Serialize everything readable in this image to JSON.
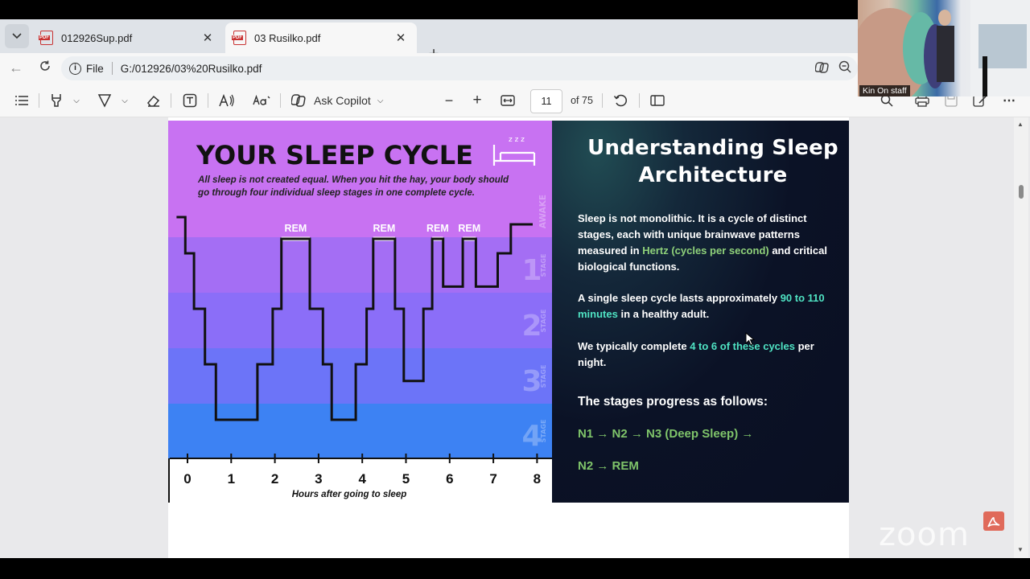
{
  "tabs": [
    {
      "title": "012926Sup.pdf",
      "close": "✕"
    },
    {
      "title": "03 Rusilko.pdf",
      "close": "✕"
    }
  ],
  "new_tab_label": "+",
  "address": {
    "scheme_label": "File",
    "url": "G:/012926/03%20Rusilko.pdf"
  },
  "pdf_toolbar": {
    "copilot_label": "Ask Copilot",
    "zoom_out": "−",
    "zoom_in": "+",
    "current_page": "11",
    "total_pages": "of 75"
  },
  "slide": {
    "title": "YOUR SLEEP CYCLE",
    "subtitle": "All sleep is not created equal. When you hit the hay, your body should go through four individual sleep stages in one complete cycle.",
    "xlabel": "Hours after going to sleep",
    "rem_label": "REM",
    "zzz": "z z z"
  },
  "chart_data": {
    "type": "line",
    "title": "YOUR SLEEP CYCLE",
    "xlabel": "Hours after going to sleep",
    "ylabel": "",
    "x_ticks": [
      "0",
      "1",
      "2",
      "3",
      "4",
      "5",
      "6",
      "7",
      "8"
    ],
    "xlim": [
      0,
      8
    ],
    "bands": [
      {
        "label": "AWAKE",
        "number": "",
        "color": "#c872f2"
      },
      {
        "label": "STAGE",
        "number": "1",
        "color": "#a46ef4"
      },
      {
        "label": "STAGE",
        "number": "2",
        "color": "#8b6ef8"
      },
      {
        "label": "STAGE",
        "number": "3",
        "color": "#6c74f8"
      },
      {
        "label": "STAGE",
        "number": "4",
        "color": "#3d82f3"
      }
    ],
    "stage_levels": {
      "awake": 0,
      "rem": 0.6,
      "stage1": 1,
      "stage2": 2,
      "stage3": 3,
      "stage4": 4
    },
    "hypnogram": [
      [
        -0.25,
        0
      ],
      [
        -0.05,
        0
      ],
      [
        -0.05,
        1
      ],
      [
        0.15,
        1
      ],
      [
        0.15,
        2
      ],
      [
        0.4,
        2
      ],
      [
        0.4,
        3
      ],
      [
        0.65,
        3
      ],
      [
        0.65,
        4
      ],
      [
        1.6,
        4
      ],
      [
        1.6,
        3
      ],
      [
        1.95,
        3
      ],
      [
        1.95,
        2
      ],
      [
        2.15,
        2
      ],
      [
        2.15,
        0.6
      ],
      [
        2.8,
        0.6
      ],
      [
        2.8,
        2
      ],
      [
        3.1,
        2
      ],
      [
        3.1,
        3
      ],
      [
        3.3,
        3
      ],
      [
        3.3,
        4
      ],
      [
        3.85,
        4
      ],
      [
        3.85,
        3
      ],
      [
        4.1,
        3
      ],
      [
        4.1,
        2
      ],
      [
        4.25,
        2
      ],
      [
        4.25,
        0.6
      ],
      [
        4.75,
        0.6
      ],
      [
        4.75,
        2
      ],
      [
        4.95,
        2
      ],
      [
        4.95,
        3.3
      ],
      [
        5.4,
        3.3
      ],
      [
        5.4,
        2
      ],
      [
        5.6,
        2
      ],
      [
        5.6,
        0.6
      ],
      [
        5.85,
        0.6
      ],
      [
        5.85,
        1.6
      ],
      [
        6.3,
        1.6
      ],
      [
        6.3,
        0.6
      ],
      [
        6.6,
        0.6
      ],
      [
        6.6,
        1.6
      ],
      [
        7.1,
        1.6
      ],
      [
        7.1,
        1
      ],
      [
        7.4,
        1
      ],
      [
        7.4,
        0.2
      ],
      [
        7.9,
        0.2
      ]
    ],
    "rem_periods": [
      [
        2.15,
        2.8
      ],
      [
        4.25,
        4.75
      ],
      [
        5.6,
        5.85
      ],
      [
        6.3,
        6.6
      ]
    ]
  },
  "right_panel": {
    "title": "Understanding Sleep Architecture",
    "p1_a": "Sleep is not monolithic. It is a cycle of distinct stages, each with unique brainwave patterns measured in ",
    "p1_hl": "Hertz (cycles per second)",
    "p1_b": " and critical biological functions.",
    "p2_a": "A single sleep cycle lasts approximately ",
    "p2_hl": "90 to 110 minutes",
    "p2_b": " in a healthy adult.",
    "p3_a": "We typically complete ",
    "p3_hl": "4 to 6 of these cycles",
    "p3_b": " per night.",
    "heading": "The stages progress as follows:",
    "flow1": "N1 → N2 → N3 (Deep Sleep) →",
    "flow2": "N2 → REM"
  },
  "zoom": {
    "watermark": "zoom",
    "participant": "Kin On staff"
  }
}
